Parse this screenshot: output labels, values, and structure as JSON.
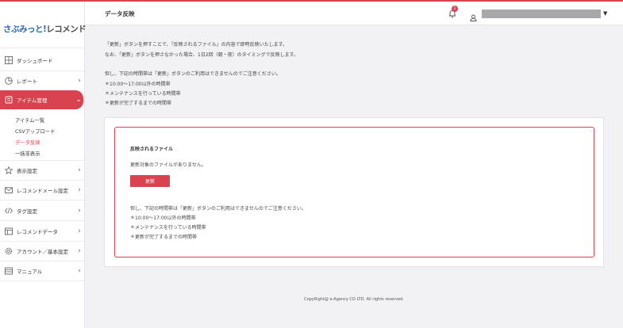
{
  "brand": {
    "logo_part1": "さぶみっと!",
    "logo_part2": "レコメンド"
  },
  "header": {
    "title": "データ反映",
    "notification_count": "1"
  },
  "sidebar": {
    "items": [
      {
        "label": "ダッシュボード",
        "icon": "dashboard-icon"
      },
      {
        "label": "レポート",
        "icon": "pie-chart-icon"
      },
      {
        "label": "アイテム管理",
        "icon": "item-icon"
      },
      {
        "label": "表示設定",
        "icon": "star-icon"
      },
      {
        "label": "レコメンドメール設定",
        "icon": "mail-icon"
      },
      {
        "label": "タグ設定",
        "icon": "code-icon"
      },
      {
        "label": "レコメンドデータ",
        "icon": "data-icon"
      },
      {
        "label": "アカウント／基本設定",
        "icon": "gear-icon"
      },
      {
        "label": "マニュアル",
        "icon": "book-icon"
      }
    ],
    "sub_items": [
      {
        "label": "アイテム一覧"
      },
      {
        "label": "CSVアップロード"
      },
      {
        "label": "データ反映"
      },
      {
        "label": "一括非表示"
      }
    ]
  },
  "intro": {
    "line1": "「更新」ボタンを押すことで、『反映されるファイル』の内容で即時反映いたします。",
    "line2": "なお、「更新」ボタンを押さなかった場合、1日2回（朝・夜）のタイミングで反映します。",
    "line3": "但し、下記の時間帯は「更新」ボタンのご利用はできませんのでご注意ください。",
    "bullet1": "＊10:00～17:00以外の時間帯",
    "bullet2": "＊メンテナンスを行っている時間帯",
    "bullet3": "＊更新が完了するまでの時間帯"
  },
  "panel": {
    "title": "反映されるファイル",
    "empty_message": "更新対象のファイルがありません。",
    "update_button": "更新",
    "note": "但し、下記の時間帯は「更新」ボタンのご利用はできませんのでご注意ください。",
    "bullet1": "＊10:00～17:00以外の時間帯",
    "bullet2": "＊メンテナンスを行っている時間帯",
    "bullet3": "＊更新が完了するまでの時間帯"
  },
  "footer": {
    "copyright": "CopyRight@ e-Agency CO LTD. All rights reserved."
  },
  "colors": {
    "accent": "#d9434f",
    "brand_blue": "#2b66b8"
  }
}
